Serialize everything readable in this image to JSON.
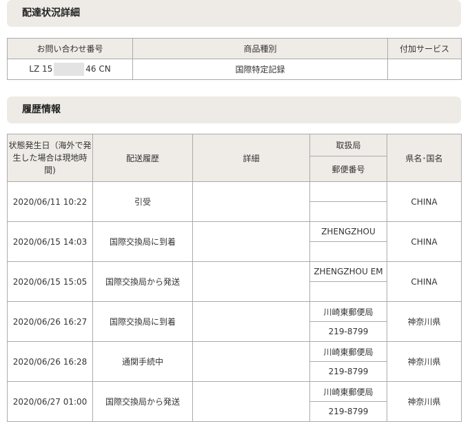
{
  "summary": {
    "title": "配達状況詳細",
    "headers": {
      "number": "お問い合わせ番号",
      "kind": "商品種別",
      "service": "付加サービス"
    },
    "row": {
      "number_prefix": "LZ 15",
      "number_suffix": "46 CN",
      "kind": "国際特定記録",
      "service": ""
    }
  },
  "history": {
    "title": "履歴情報",
    "headers": {
      "date": "状態発生日（海外で発生した場合は現地時間)",
      "status": "配送履歴",
      "detail": "詳細",
      "office": "取扱局",
      "postal": "郵便番号",
      "region": "県名･国名"
    },
    "rows": [
      {
        "date": "2020/06/11 10:22",
        "status": "引受",
        "detail": "",
        "office": "",
        "postal": "",
        "region": "CHINA"
      },
      {
        "date": "2020/06/15 14:03",
        "status": "国際交換局に到着",
        "detail": "",
        "office": "ZHENGZHOU",
        "postal": "",
        "region": "CHINA"
      },
      {
        "date": "2020/06/15 15:05",
        "status": "国際交換局から発送",
        "detail": "",
        "office": "ZHENGZHOU EM",
        "postal": "",
        "region": "CHINA"
      },
      {
        "date": "2020/06/26 16:27",
        "status": "国際交換局に到着",
        "detail": "",
        "office": "川崎東郵便局",
        "postal": "219-8799",
        "region": "神奈川県"
      },
      {
        "date": "2020/06/26 16:28",
        "status": "通関手続中",
        "detail": "",
        "office": "川崎東郵便局",
        "postal": "219-8799",
        "region": "神奈川県"
      },
      {
        "date": "2020/06/27 01:00",
        "status": "国際交換局から発送",
        "detail": "",
        "office": "川崎東郵便局",
        "postal": "219-8799",
        "region": "神奈川県"
      }
    ]
  }
}
